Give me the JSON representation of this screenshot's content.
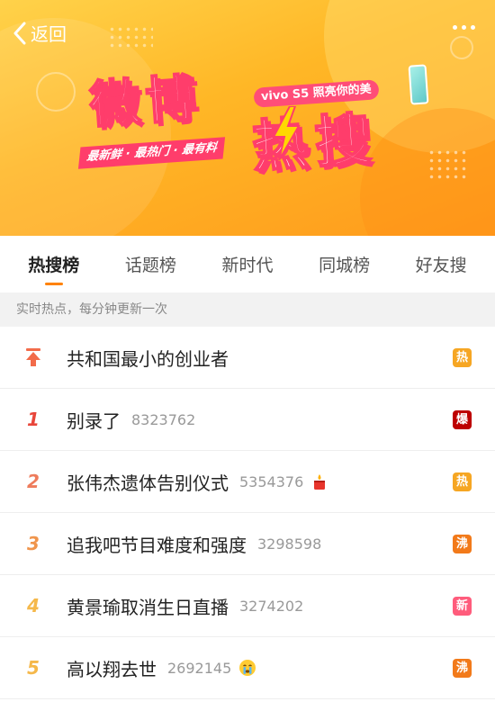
{
  "header": {
    "back_label": "返回",
    "back_icon": "chevron-left-icon",
    "more_icon": "more-dots-icon"
  },
  "banner": {
    "logo_line1": "微博",
    "logo_line2": "热搜",
    "sponsor_text": "vivo S5 照亮你的美",
    "slogan": "最新鲜 · 最热门 · 最有料",
    "colors": {
      "background": "#ffb726",
      "accent": "#ff3d6b"
    }
  },
  "tabs": [
    {
      "label": "热搜榜",
      "active": true
    },
    {
      "label": "话题榜",
      "active": false
    },
    {
      "label": "新时代",
      "active": false
    },
    {
      "label": "同城榜",
      "active": false
    },
    {
      "label": "好友搜",
      "active": false
    }
  ],
  "notice": "实时热点，每分钟更新一次",
  "list": [
    {
      "rank": "",
      "pinned": true,
      "title": "共和国最小的创业者",
      "count": "",
      "emoji": "",
      "badge": "热",
      "badge_color": "#f6a623"
    },
    {
      "rank": "1",
      "pinned": false,
      "title": "别录了",
      "count": "8323762",
      "emoji": "",
      "badge": "爆",
      "badge_color": "#bd0000"
    },
    {
      "rank": "2",
      "pinned": false,
      "title": "张伟杰遗体告别仪式",
      "count": "5354376",
      "emoji": "candle-emoji",
      "badge": "热",
      "badge_color": "#f6a623"
    },
    {
      "rank": "3",
      "pinned": false,
      "title": "追我吧节目难度和强度",
      "count": "3298598",
      "emoji": "",
      "badge": "沸",
      "badge_color": "#f27a1a"
    },
    {
      "rank": "4",
      "pinned": false,
      "title": "黄景瑜取消生日直播",
      "count": "3274202",
      "emoji": "",
      "badge": "新",
      "badge_color": "#ff5c7c"
    },
    {
      "rank": "5",
      "pinned": false,
      "title": "高以翔去世",
      "count": "2692145",
      "emoji": "crying-emoji",
      "badge": "沸",
      "badge_color": "#f27a1a"
    }
  ],
  "colors": {
    "tab_underline": "#ff8200",
    "rank_1": "#e8463a",
    "rank_2": "#ee7c5c",
    "rank_3": "#f0954c",
    "rank_other": "#f5b84a"
  }
}
